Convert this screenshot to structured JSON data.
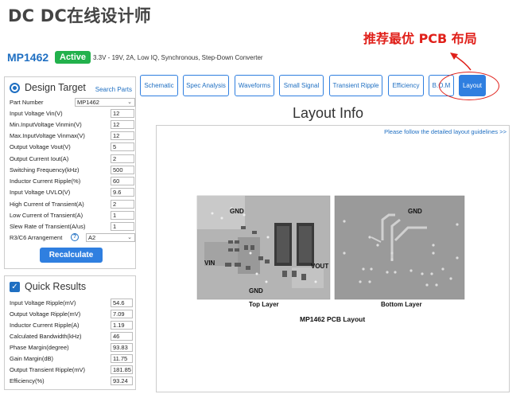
{
  "header": {
    "title": "DC DC在线设计师",
    "annotation": "推荐最优 PCB 布局"
  },
  "part": {
    "name": "MP1462",
    "status": "Active",
    "description": "3.3V - 19V, 2A, Low IQ, Synchronous, Step-Down Converter"
  },
  "design_target": {
    "title": "Design Target",
    "search_parts": "Search Parts",
    "part_number_label": "Part Number",
    "part_number_value": "MP1462",
    "params": [
      {
        "label": "Input Voltage Vin(V)",
        "value": "12"
      },
      {
        "label": "Min.InputVoltage Vinmin(V)",
        "value": "12"
      },
      {
        "label": "Max.InputVoltage Vinmax(V)",
        "value": "12"
      },
      {
        "label": "Output Voltage Vout(V)",
        "value": "5"
      },
      {
        "label": "Output Current Iout(A)",
        "value": "2"
      },
      {
        "label": "Switching Frequency(kHz)",
        "value": "500"
      },
      {
        "label": "Inductor Current Ripple(%)",
        "value": "60"
      },
      {
        "label": "Input Voltage UVLO(V)",
        "value": "9.6"
      },
      {
        "label": "High Current of Transient(A)",
        "value": "2"
      },
      {
        "label": "Low Current of Transient(A)",
        "value": "1"
      },
      {
        "label": "Slew Rate of Transient(A/us)",
        "value": "1"
      }
    ],
    "arrangement_label": "R3/C6 Arrangement",
    "arrangement_value": "A2",
    "recalc_label": "Recalculate"
  },
  "quick_results": {
    "title": "Quick Results",
    "rows": [
      {
        "label": "Input Voltage Ripple(mV)",
        "value": "54.6"
      },
      {
        "label": "Output Voltage Ripple(mV)",
        "value": "7.09"
      },
      {
        "label": "Inductor Current Ripple(A)",
        "value": "1.19"
      },
      {
        "label": "Calculated Bandwidth(kHz)",
        "value": "46"
      },
      {
        "label": "Phase Margin(degree)",
        "value": "93.83"
      },
      {
        "label": "Gain Margin(dB)",
        "value": "11.75"
      },
      {
        "label": "Output Transient Ripple(mV)",
        "value": "181.85"
      },
      {
        "label": "Efficiency(%)",
        "value": "93.24"
      }
    ]
  },
  "tabs": [
    {
      "label": "Schematic"
    },
    {
      "label": "Spec Analysis"
    },
    {
      "label": "Waveforms"
    },
    {
      "label": "Small Signal"
    },
    {
      "label": "Transient Ripple"
    },
    {
      "label": "Efficiency"
    },
    {
      "label": "B.O.M"
    },
    {
      "label": "Layout"
    }
  ],
  "layout": {
    "title": "Layout Info",
    "guide_link": "Please follow the detailed layout guidelines >>",
    "top_layer": {
      "caption": "Top Layer",
      "gnd_top": "GND",
      "gnd_bottom": "GND",
      "vin": "VIN",
      "vout": "VOUT"
    },
    "bottom_layer": {
      "caption": "Bottom Layer",
      "gnd": "GND"
    },
    "figure_caption": "MP1462 PCB Layout"
  },
  "colors": {
    "accent": "#2f7fe0",
    "link": "#1f6fc2",
    "active_badge": "#22b14c",
    "annotation_red": "#e0201a"
  }
}
